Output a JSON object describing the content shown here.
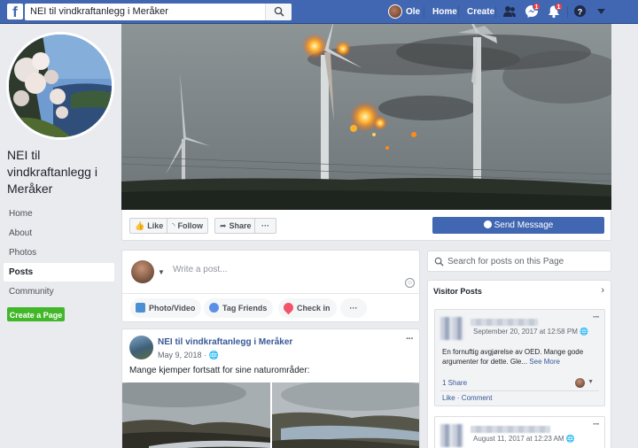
{
  "topbar": {
    "search_value": "NEI til vindkraftanlegg i Meråker",
    "user_name": "Ole",
    "home_label": "Home",
    "create_label": "Create",
    "messages_badge": "1",
    "notifications_badge": "1",
    "logo_letter": "f"
  },
  "page": {
    "title": "NEI til vindkraftanlegg i Meråker"
  },
  "left_nav": {
    "items": [
      {
        "label": "Home"
      },
      {
        "label": "About"
      },
      {
        "label": "Photos"
      },
      {
        "label": "Posts"
      },
      {
        "label": "Community"
      }
    ],
    "create_page": "Create a Page"
  },
  "actions": {
    "like": "Like",
    "follow": "Follow",
    "share": "Share",
    "more": "···",
    "send_message": "Send Message"
  },
  "composer": {
    "placeholder": "Write a post...",
    "photo_video": "Photo/Video",
    "tag_friends": "Tag Friends",
    "check_in": "Check in",
    "more": "···"
  },
  "post": {
    "author": "NEI til vindkraftanlegg i Meråker",
    "date": "May 9, 2018 ·",
    "text": "Mange kjemper fortsatt for sine naturområder:",
    "more": "···"
  },
  "right": {
    "search_placeholder": "Search for posts on this Page",
    "visitor_header": "Visitor Posts",
    "posts": [
      {
        "date": "September 20, 2017 at 12:58 PM",
        "text": "En fornuftig avgjørelse av OED. Mange gode argumenter for dette. Gle...",
        "see_more": "See More",
        "shares": "1 Share",
        "like": "Like",
        "comment": "Comment",
        "more": "···"
      },
      {
        "date": "August 11, 2017 at 12:23 AM",
        "more": "···"
      }
    ]
  },
  "colors": {
    "brand": "#4267b2",
    "link": "#385898",
    "create_green": "#42b72a",
    "badge_red": "#fa3e3e"
  },
  "icons": [
    "facebook-logo-icon",
    "search-icon",
    "friends-icon",
    "messenger-icon",
    "bell-icon",
    "help-icon",
    "caret-down-icon",
    "globe-icon"
  ]
}
